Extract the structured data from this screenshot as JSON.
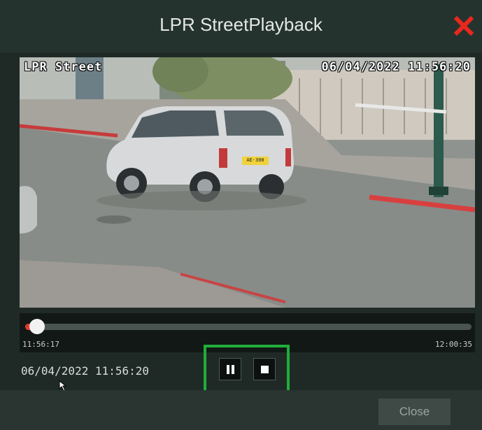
{
  "dialog": {
    "title": "LPR StreetPlayback",
    "close_label": "Close"
  },
  "video": {
    "osd_camera_name": "LPR Street",
    "osd_timestamp": "06/04/2022 11:56:20",
    "plate_text": "AE·300"
  },
  "playback": {
    "start_time": "11:56:17",
    "end_time": "12:00:35",
    "current_time": "06/04/2022 11:56:20",
    "progress_percent": 1.2
  },
  "icons": {
    "close": "close-x-icon",
    "pause": "pause-icon",
    "stop": "stop-icon"
  },
  "colors": {
    "close_x": "#e8281e",
    "progress_played": "#e23a2e",
    "highlight": "#1fae3a"
  }
}
